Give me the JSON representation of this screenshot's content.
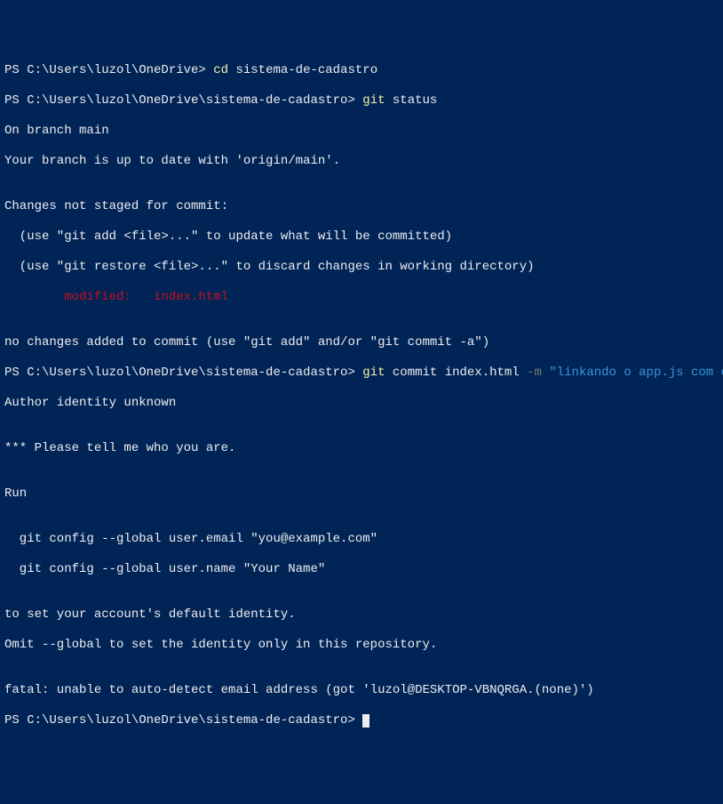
{
  "l1": {
    "prompt": "PS C:\\Users\\luzol\\OneDrive> ",
    "cmd": "cd",
    "arg": " sistema-de-cadastro"
  },
  "l2": {
    "prompt": "PS C:\\Users\\luzol\\OneDrive\\sistema-de-cadastro> ",
    "cmd": "git",
    "arg": " status"
  },
  "l3": "On branch main",
  "l4": "Your branch is up to date with 'origin/main'.",
  "l5": "",
  "l6": "Changes not staged for commit:",
  "l7": "  (use \"git add <file>...\" to update what will be committed)",
  "l8": "  (use \"git restore <file>...\" to discard changes in working directory)",
  "l9": "        modified:   index.html",
  "l10": "",
  "l11": "no changes added to commit (use \"git add\" and/or \"git commit -a\")",
  "l12": {
    "prompt": "PS C:\\Users\\luzol\\OneDrive\\sistema-de-cadastro> ",
    "cmd": "git",
    "arg": " commit index.html ",
    "flag": "-m ",
    "msg": "\"linkando o app.js com o html\""
  },
  "l13": "Author identity unknown",
  "l14": "",
  "l15": "*** Please tell me who you are.",
  "l16": "",
  "l17": "Run",
  "l18": "",
  "l19": "  git config --global user.email \"you@example.com\"",
  "l20": "  git config --global user.name \"Your Name\"",
  "l21": "",
  "l22": "to set your account's default identity.",
  "l23": "Omit --global to set the identity only in this repository.",
  "l24": "",
  "l25": "fatal: unable to auto-detect email address (got 'luzol@DESKTOP-VBNQRGA.(none)')",
  "l26": {
    "prompt": "PS C:\\Users\\luzol\\OneDrive\\sistema-de-cadastro> "
  }
}
